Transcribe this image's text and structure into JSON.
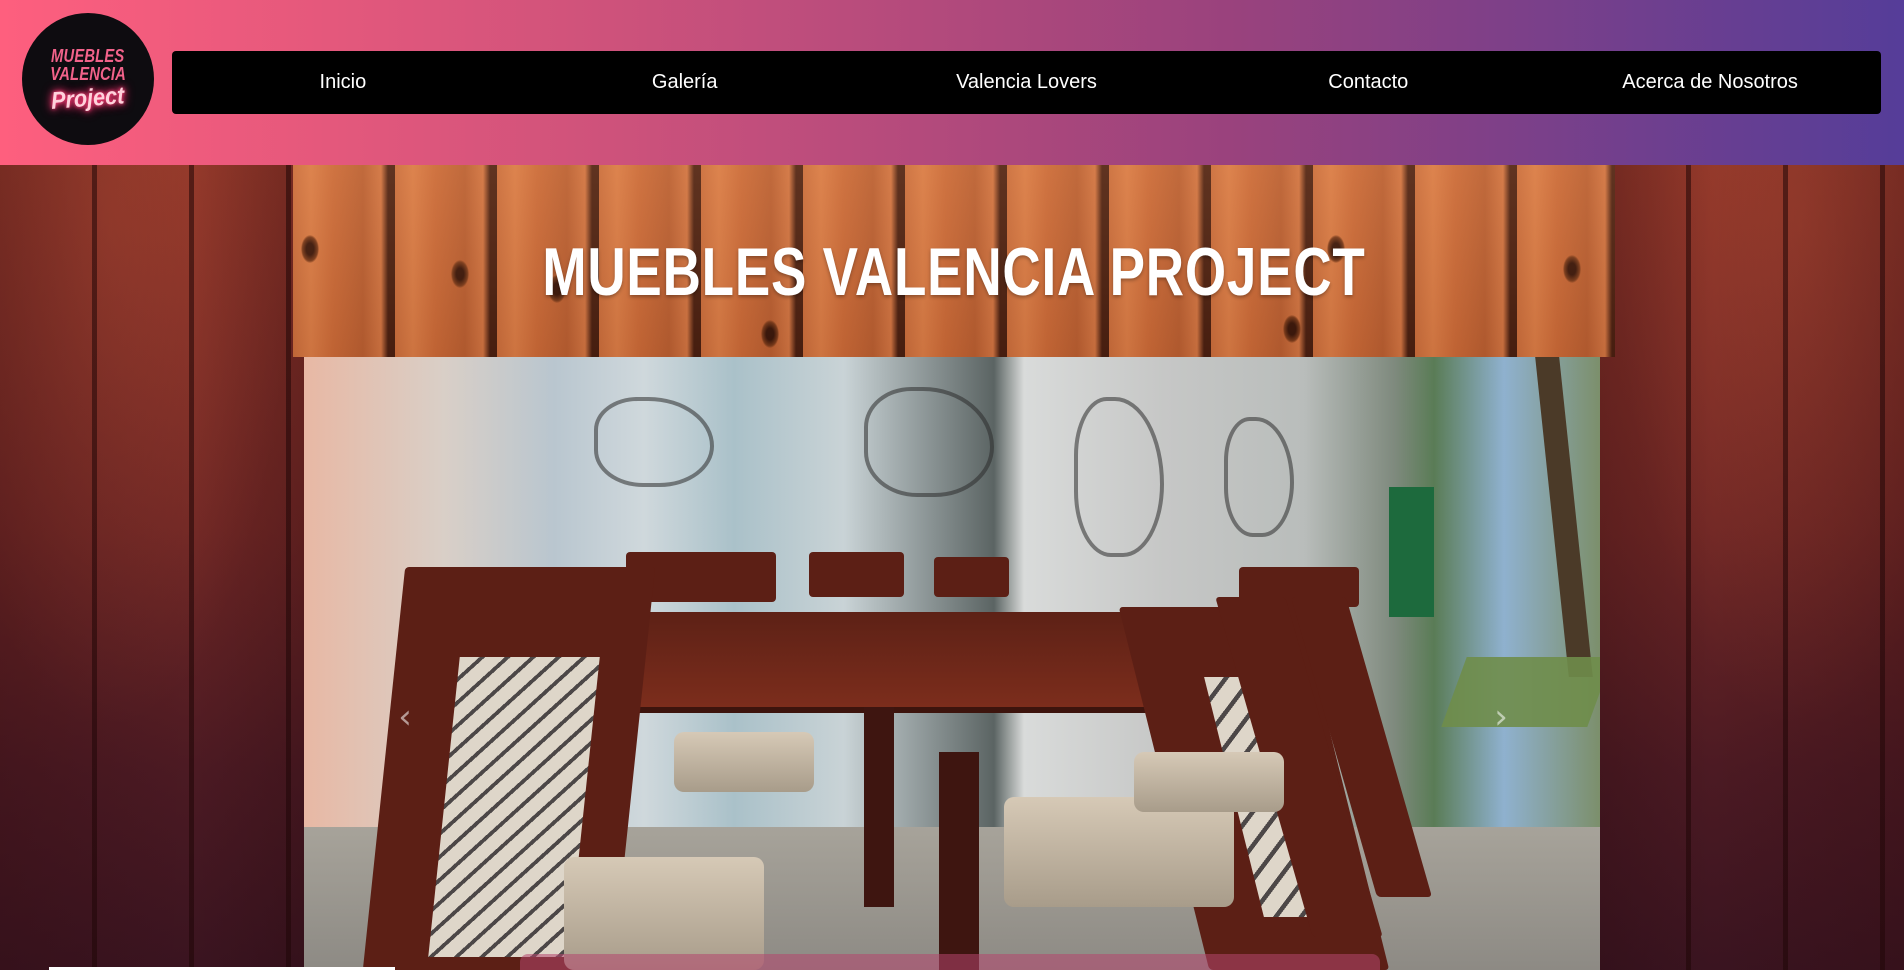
{
  "header": {
    "logo": {
      "line1": "MUEBLES",
      "line2": "VALENCIA",
      "line3": "Project"
    },
    "nav": [
      {
        "label": "Inicio"
      },
      {
        "label": "Galería"
      },
      {
        "label": "Valencia Lovers"
      },
      {
        "label": "Contacto"
      },
      {
        "label": "Acerca de Nosotros"
      }
    ]
  },
  "hero": {
    "title": "MUEBLES VALENCIA PROJECT"
  },
  "carousel": {
    "prev_icon": "chevron-left-icon",
    "next_icon": "chevron-right-icon",
    "prev_glyph": "‹",
    "next_glyph": "›",
    "slide_description_alt": "Juego de comedor de madera con sillas tapizadas"
  },
  "colors": {
    "header_gradient_start": "#fe5f7e",
    "header_gradient_end": "#553d99",
    "nav_bg": "#000000",
    "nav_text": "#ffffff",
    "title_text": "#ffffff"
  }
}
